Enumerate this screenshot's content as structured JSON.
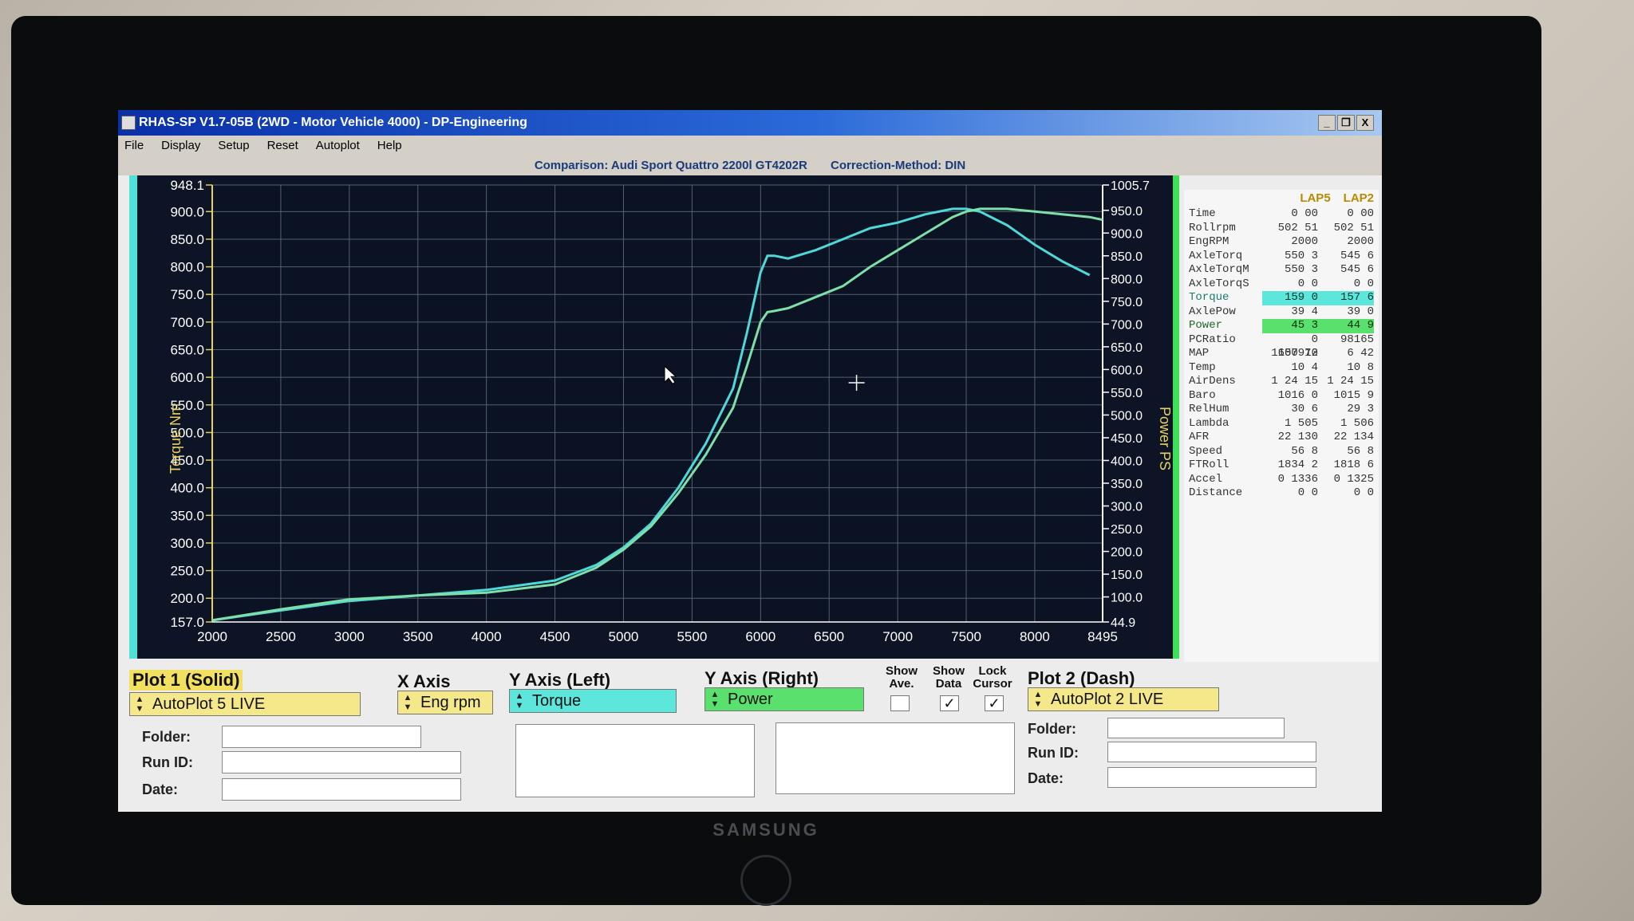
{
  "window": {
    "title": "RHAS-SP V1.7-05B  (2WD - Motor Vehicle 4000) - DP-Engineering",
    "buttons": [
      "_",
      "b",
      "X"
    ]
  },
  "menu": [
    "File",
    "Display",
    "Setup",
    "Reset",
    "Autoplot",
    "Help"
  ],
  "comparison": {
    "text": "Comparison: Audi Sport Quattro 2200l GT4202R",
    "correction": "Correction-Method: DIN"
  },
  "chart_data": {
    "type": "line",
    "xlabel": "",
    "ylabel_left": "Torque Nm",
    "ylabel_right": "Power PS",
    "xlim": [
      2000,
      8495
    ],
    "ylim_left": [
      157.0,
      948.1
    ],
    "ylim_right": [
      44.9,
      1005.7
    ],
    "x_ticks": [
      "2000",
      "2500",
      "3000",
      "3500",
      "4000",
      "4500",
      "5000",
      "5500",
      "6000",
      "6500",
      "7000",
      "7500",
      "8000",
      "8495"
    ],
    "y_left_ticks": [
      "948.1",
      "900.0",
      "850.0",
      "800.0",
      "750.0",
      "700.0",
      "650.0",
      "600.0",
      "550.0",
      "500.0",
      "450.0",
      "400.0",
      "350.0",
      "300.0",
      "250.0",
      "200.0",
      "157.0"
    ],
    "y_right_ticks": [
      "1005.7",
      "950.0",
      "900.0",
      "850.0",
      "800.0",
      "750.0",
      "700.0",
      "650.0",
      "600.0",
      "550.0",
      "500.0",
      "450.0",
      "400.0",
      "350.0",
      "300.0",
      "250.0",
      "200.0",
      "150.0",
      "100.0",
      "44.9"
    ],
    "grid": true,
    "series": [
      {
        "color": "#4fd8d8",
        "axis": "left",
        "x": [
          2000,
          2500,
          3000,
          3500,
          4000,
          4500,
          4800,
          5000,
          5200,
          5400,
          5600,
          5800,
          5900,
          6000,
          6050,
          6100,
          6200,
          6400,
          6600,
          6800,
          7000,
          7200,
          7400,
          7500,
          7600,
          7800,
          8000,
          8200,
          8400
        ],
        "y": [
          160,
          178,
          195,
          205,
          215,
          232,
          260,
          292,
          335,
          400,
          480,
          580,
          680,
          790,
          820,
          820,
          815,
          830,
          850,
          870,
          880,
          895,
          905,
          905,
          900,
          875,
          840,
          810,
          785
        ]
      },
      {
        "color": "#7ee0a8",
        "axis": "left",
        "x": [
          2000,
          2500,
          3000,
          3500,
          4000,
          4500,
          4800,
          5000,
          5200,
          5400,
          5600,
          5800,
          5900,
          6000,
          6050,
          6100,
          6200,
          6400,
          6600,
          6800,
          7000,
          7200,
          7400,
          7500,
          7600,
          7800,
          8000,
          8200,
          8400,
          8495
        ],
        "y": [
          160,
          180,
          198,
          205,
          210,
          225,
          255,
          288,
          330,
          390,
          460,
          545,
          620,
          700,
          718,
          720,
          725,
          745,
          765,
          800,
          830,
          860,
          890,
          900,
          905,
          905,
          900,
          895,
          890,
          885
        ]
      }
    ]
  },
  "data_panel": {
    "headers": [
      "LAP5",
      "LAP2"
    ],
    "rows": [
      {
        "label": "Time",
        "v1": "0 00",
        "v2": "0 00"
      },
      {
        "label": "Rollrpm",
        "v1": "502 51",
        "v2": "502 51"
      },
      {
        "label": "EngRPM",
        "v1": "2000",
        "v2": "2000"
      },
      {
        "label": "AxleTorq",
        "v1": "550 3",
        "v2": "545 6"
      },
      {
        "label": "AxleTorqM",
        "v1": "550 3",
        "v2": "545 6"
      },
      {
        "label": "AxleTorqS",
        "v1": "0 0",
        "v2": "0 0"
      },
      {
        "label": "Torque",
        "v1": "159 0",
        "v2": "157 6",
        "hl": "t"
      },
      {
        "label": "AxlePow",
        "v1": "39 4",
        "v2": "39 0"
      },
      {
        "label": "Power",
        "v1": "45 3",
        "v2": "44 9",
        "hl": "p"
      },
      {
        "label": "PCRatio",
        "v1": "0 1650910",
        "v2": "98165"
      },
      {
        "label": "MAP",
        "v1": "107 72",
        "v2": "6 42"
      },
      {
        "label": "Temp",
        "v1": "10 4",
        "v2": "10 8"
      },
      {
        "label": "AirDens",
        "v1": "1 24 15",
        "v2": "1 24 15"
      },
      {
        "label": "Baro",
        "v1": "1016 0",
        "v2": "1015 9"
      },
      {
        "label": "RelHum",
        "v1": "30 6",
        "v2": "29 3"
      },
      {
        "label": "Lambda",
        "v1": "1 505",
        "v2": "1 506"
      },
      {
        "label": "AFR",
        "v1": "22 130",
        "v2": "22 134"
      },
      {
        "label": "Speed",
        "v1": "56 8",
        "v2": "56 8"
      },
      {
        "label": "FTRoll",
        "v1": "1834 2",
        "v2": "1818 6"
      },
      {
        "label": "Accel",
        "v1": "0 1336",
        "v2": "0 1325"
      },
      {
        "label": "Distance",
        "v1": "0 0",
        "v2": "0 0"
      }
    ]
  },
  "controls": {
    "plot1_label": "Plot 1 (Solid)",
    "plot1_select": "AutoPlot 5 LIVE",
    "xaxis_label": "X Axis",
    "xaxis_select": "Eng rpm",
    "yleft_label": "Y Axis (Left)",
    "yleft_select": "Torque",
    "yright_label": "Y Axis (Right)",
    "yright_select": "Power",
    "show_ave_label": "Show Ave.",
    "show_data_label": "Show Data",
    "lock_cursor_label": "Lock Cursor",
    "plot2_label": "Plot 2 (Dash)",
    "plot2_select": "AutoPlot 2 LIVE",
    "folder_label": "Folder:",
    "runid_label": "Run ID:",
    "date_label": "Date:",
    "show_ave_checked": false,
    "show_data_checked": true,
    "lock_cursor_checked": true
  },
  "monitor": {
    "brand": "SAMSUNG"
  },
  "colors": {
    "torque": "#5de6dc",
    "power": "#5ae06c",
    "plot_bg": "#0c1426"
  }
}
